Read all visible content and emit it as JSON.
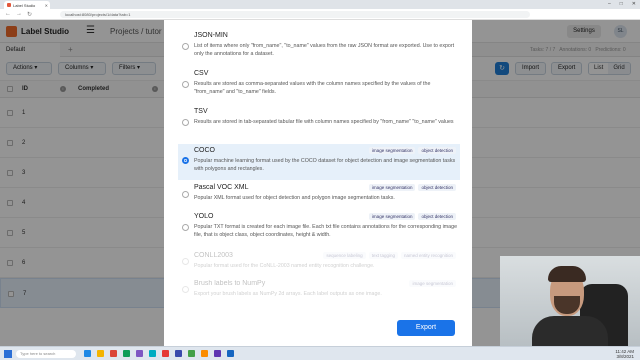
{
  "browser": {
    "tab_title": "Label Studio",
    "url": "localhost:8080/projects/1/data?tab=1",
    "window_controls": [
      "–",
      "□",
      "✕"
    ]
  },
  "app": {
    "name": "Label Studio",
    "breadcrumbs": "Projects  /  tutor",
    "settings_label": "Settings",
    "avatar_initials": "SL"
  },
  "view_tabs": {
    "active": "Default",
    "add_label": "+"
  },
  "stats": {
    "tasks": "Tasks: 7 / 7",
    "annotations": "Annotations: 0",
    "predictions": "Predictions: 0"
  },
  "toolbar": {
    "actions_label": "Actions",
    "columns_label": "Columns",
    "filters_label": "Filters",
    "import_label": "Import",
    "export_label": "Export",
    "list_label": "List",
    "grid_label": "Grid"
  },
  "table": {
    "headers": [
      "ID",
      "Completed"
    ],
    "row_ids": [
      "1",
      "2",
      "3",
      "4",
      "5",
      "6",
      "7"
    ]
  },
  "export_dialog": {
    "formats": [
      {
        "name": "JSON-MIN",
        "description": "List of items where only \"from_name\", \"to_name\" values from the raw JSON format are exported. Use to export only the annotations for a dataset.",
        "tags": [],
        "selected": false,
        "disabled": false
      },
      {
        "name": "CSV",
        "description": "Results are stored as comma-separated values with the column names specified by the values of the \"from_name\" and \"to_name\" fields.",
        "tags": [],
        "selected": false,
        "disabled": false
      },
      {
        "name": "TSV",
        "description": "Results are stored in tab-separated tabular file with column names specified by \"from_name\" \"to_name\" values",
        "tags": [],
        "selected": false,
        "disabled": false
      },
      {
        "name": "COCO",
        "description": "Popular machine learning format used by the COCO dataset for object detection and image segmentation tasks with polygons and rectangles.",
        "tags": [
          "image segmentation",
          "object detection"
        ],
        "selected": true,
        "disabled": false
      },
      {
        "name": "Pascal VOC XML",
        "description": "Popular XML format used for object detection and polygon image segmentation tasks.",
        "tags": [
          "image segmentation",
          "object detection"
        ],
        "selected": false,
        "disabled": false
      },
      {
        "name": "YOLO",
        "description": "Popular TXT format is created for each image file. Each txt file contains annotations for the corresponding image file, that is object class, object coordinates, height & width.",
        "tags": [
          "image segmentation",
          "object detection"
        ],
        "selected": false,
        "disabled": false
      },
      {
        "name": "CONLL2003",
        "description": "Popular format used for the CoNLL-2003 named entity recognition challenge.",
        "tags": [
          "sequence labeling",
          "text tagging",
          "named entity recognition"
        ],
        "selected": false,
        "disabled": true
      },
      {
        "name": "Brush labels to NumPy",
        "description": "Export your brush labels as NumPy 2d arrays. Each label outputs as one image.",
        "tags": [
          "image segmentation"
        ],
        "selected": false,
        "disabled": true
      }
    ],
    "export_button": "Export"
  },
  "taskbar": {
    "search_placeholder": "Type here to search",
    "time": "11:42 AM",
    "date": "3/8/2021"
  }
}
